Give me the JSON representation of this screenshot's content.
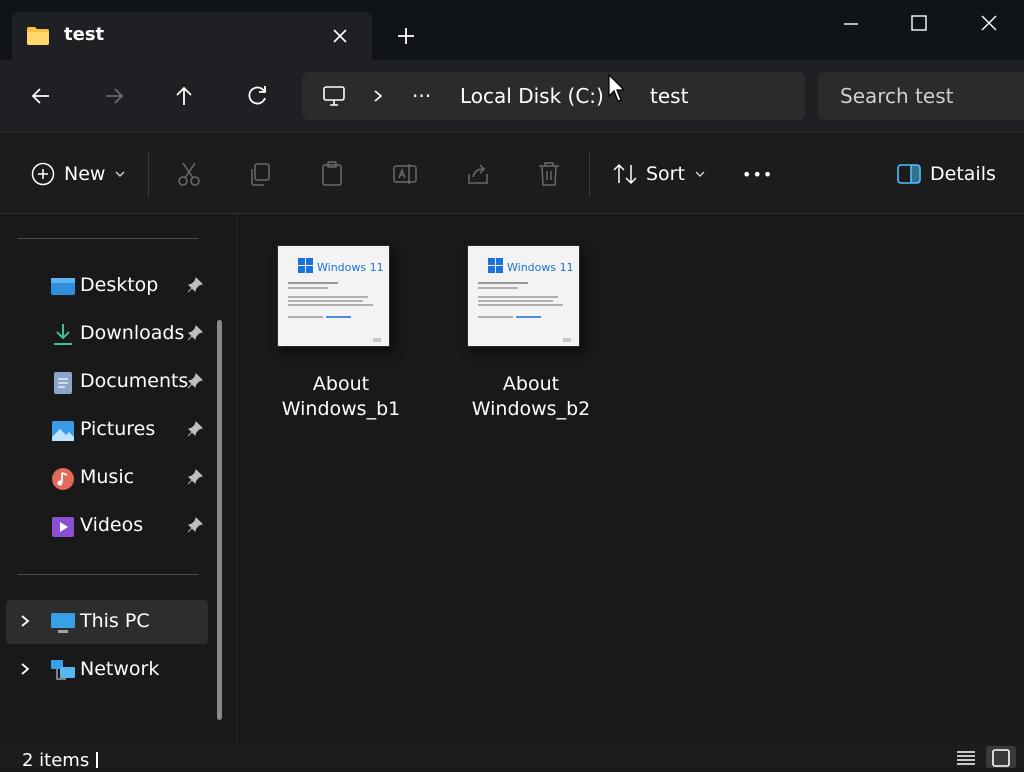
{
  "tab": {
    "title": "test"
  },
  "breadcrumb": {
    "ellipsis": "···",
    "drive": "Local Disk (C:)",
    "folder": "test"
  },
  "search": {
    "placeholder": "Search test"
  },
  "toolbar": {
    "new_label": "New",
    "sort_label": "Sort",
    "more_label": "•••",
    "details_label": "Details"
  },
  "sidebar": {
    "quick_access": [
      {
        "label": "Desktop",
        "icon": "desktop-icon"
      },
      {
        "label": "Downloads",
        "icon": "downloads-icon"
      },
      {
        "label": "Documents",
        "icon": "documents-icon"
      },
      {
        "label": "Pictures",
        "icon": "pictures-icon"
      },
      {
        "label": "Music",
        "icon": "music-icon"
      },
      {
        "label": "Videos",
        "icon": "videos-icon"
      }
    ],
    "this_pc": "This PC",
    "network": "Network"
  },
  "files": [
    {
      "line1": "About",
      "line2": "Windows_b1",
      "thumb_brand": "Windows 11"
    },
    {
      "line1": "About",
      "line2": "Windows_b2",
      "thumb_brand": "Windows 11"
    }
  ],
  "status": {
    "items": "2 items"
  },
  "colors": {
    "accent": "#4cc2ff",
    "folder": "#f5c342",
    "background": "#191919"
  }
}
